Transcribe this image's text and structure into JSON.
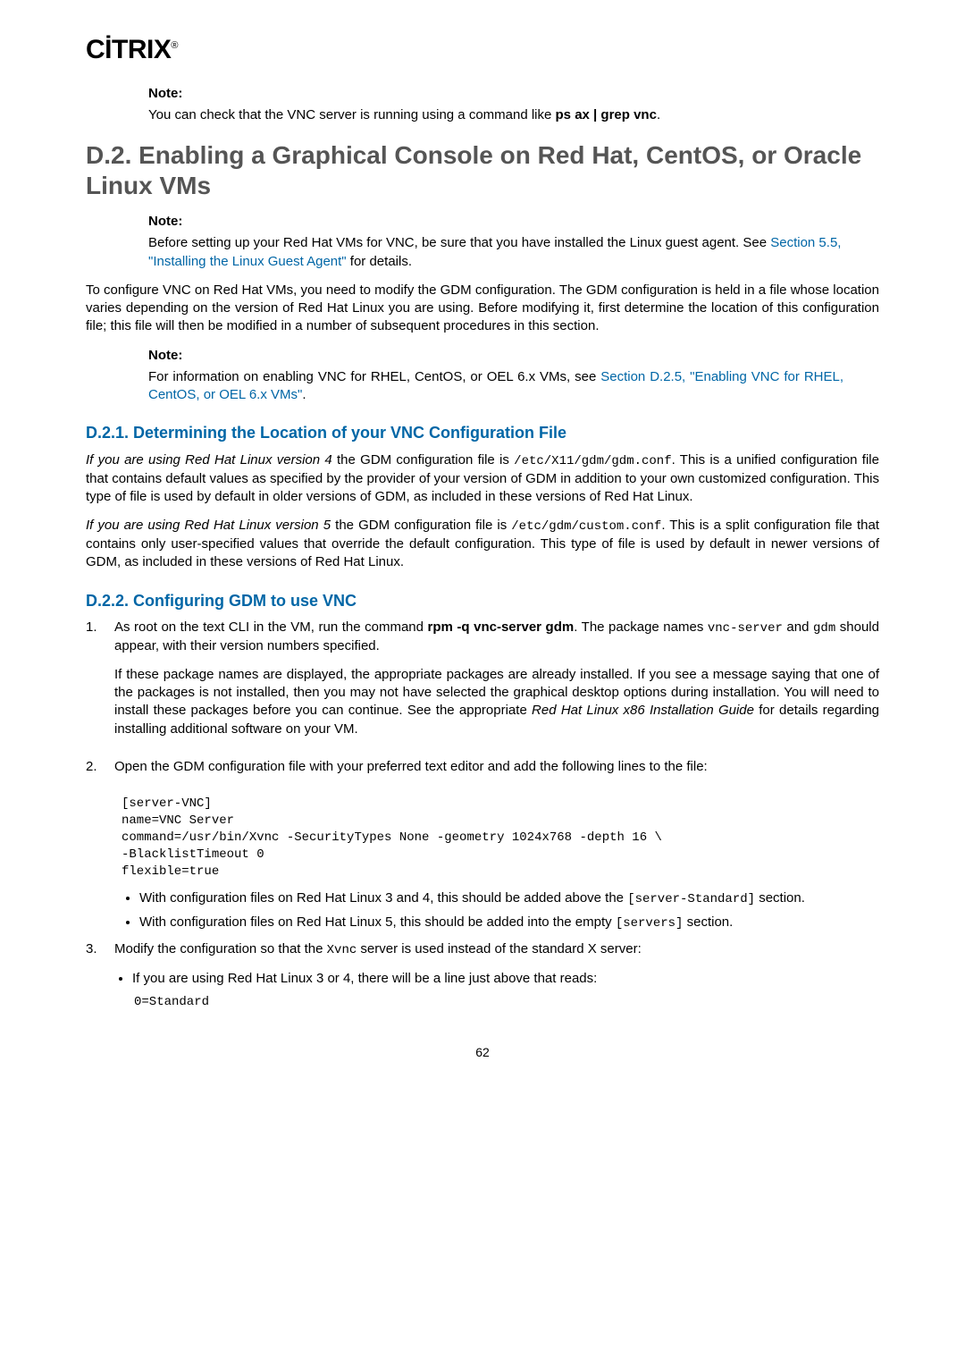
{
  "logo": "CİTRIX",
  "logo_reg": "®",
  "note1": {
    "label": "Note:",
    "text_pre": "You can check that the VNC server is running using a command like ",
    "cmd": "ps ax | grep vnc",
    "text_post": "."
  },
  "h2": "D.2. Enabling a Graphical Console on Red Hat, CentOS, or Oracle Linux VMs",
  "note2": {
    "label": "Note:",
    "text_pre": "Before setting up your Red Hat VMs for VNC, be sure that you have installed the Linux guest agent. See ",
    "link": "Section 5.5, \"Installing the Linux Guest Agent\"",
    "text_post": " for details."
  },
  "para1": "To configure VNC on Red Hat VMs, you need to modify the GDM configuration. The GDM configuration is held in a file whose location varies depending on the version of Red Hat Linux you are using. Before modifying it, first determine the location of this configuration file; this file will then be modified in a number of subsequent procedures in this section.",
  "note3": {
    "label": "Note:",
    "text_pre": "For information on enabling VNC for RHEL, CentOS, or OEL 6.x VMs, see ",
    "link": "Section D.2.5, \"Enabling VNC for RHEL, CentOS, or OEL 6.x VMs\"",
    "text_post": "."
  },
  "h3a": "D.2.1. Determining the Location of your VNC Configuration File",
  "para2_prefix_italic": "If you are using Red Hat Linux version 4",
  "para2_mid": " the GDM configuration file is ",
  "para2_code": "/etc/X11/gdm/gdm.conf",
  "para2_rest": ". This is a unified configuration file that contains default values as specified by the provider of your version of GDM in addition to your own customized configuration. This type of file is used by default in older versions of GDM, as included in these versions of Red Hat Linux.",
  "para3_prefix_italic": "If you are using Red Hat Linux version 5",
  "para3_mid": " the GDM configuration file is ",
  "para3_code": "/etc/gdm/custom.conf",
  "para3_rest": ". This is a split configuration file that contains only user-specified values that override the default configuration. This type of file is used by default in newer versions of GDM, as included in these versions of Red Hat Linux.",
  "h3b": "D.2.2. Configuring GDM to use VNC",
  "step1": {
    "num": "1.",
    "pre": "As root on the text CLI in the VM, run the command ",
    "cmd": "rpm -q vnc-server gdm",
    "mid": ". The package names ",
    "code1": "vnc-server",
    "mid2": " and ",
    "code2": "gdm",
    "post": " should appear, with their version numbers specified.",
    "para2_a": "If these package names are displayed, the appropriate packages are already installed. If you see a message saying that one of the packages is not installed, then you may not have selected the graphical desktop options during installation. You will need to install these packages before you can continue. See the appropriate ",
    "para2_italic": "Red Hat Linux x86 Installation Guide",
    "para2_b": " for details regarding installing additional software on your VM."
  },
  "step2": {
    "num": "2.",
    "text": "Open the GDM configuration file with your preferred text editor and add the following lines to the file:",
    "code": "[server-VNC]\nname=VNC Server\ncommand=/usr/bin/Xvnc -SecurityTypes None -geometry 1024x768 -depth 16 \\\n-BlacklistTimeout 0\nflexible=true",
    "b1_a": "With configuration files on Red Hat Linux 3 and 4, this should be added above the ",
    "b1_code": "[server-Standard]",
    "b1_b": " section.",
    "b2_a": "With configuration files on Red Hat Linux 5, this should be added into the empty ",
    "b2_code": "[servers]",
    "b2_b": " section."
  },
  "step3": {
    "num": "3.",
    "text_a": "Modify the configuration so that the ",
    "text_code": "Xvnc",
    "text_b": " server is used instead of the standard X server:",
    "b1": "If you are using Red Hat Linux 3 or 4, there will be a line just above that reads:",
    "code": "0=Standard"
  },
  "pagenum": "62"
}
